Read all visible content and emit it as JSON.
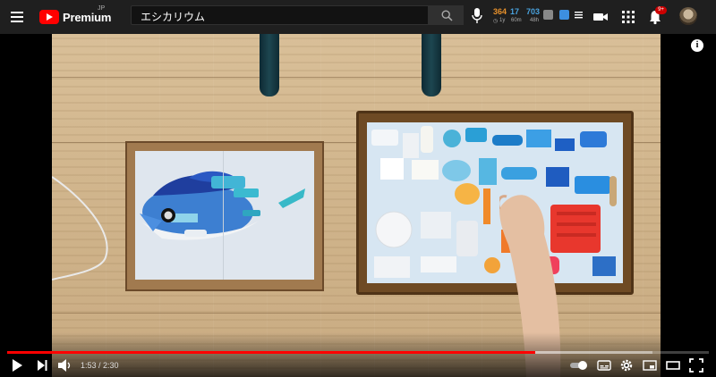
{
  "header": {
    "logo_text": "Premium",
    "logo_region": "JP",
    "search_value": "エシカリウム",
    "notifications_badge": "9+",
    "extension": {
      "stat1_value": "364",
      "stat1_sub": "1y",
      "stat2_value": "17",
      "stat2_sub": "60m",
      "stat3_value": "703",
      "stat3_sub": "48h"
    }
  },
  "player": {
    "current_time": "1:53",
    "duration": "2:30",
    "time_display": "1:53 / 2:30",
    "progress_played": 0.753,
    "progress_buffered": 0.92,
    "info_label": "i"
  },
  "colors": {
    "topbar": "#1f1f1f",
    "accent_red": "#ff0000",
    "stat_orange": "#e8912b",
    "stat_blue": "#4aa3df"
  }
}
